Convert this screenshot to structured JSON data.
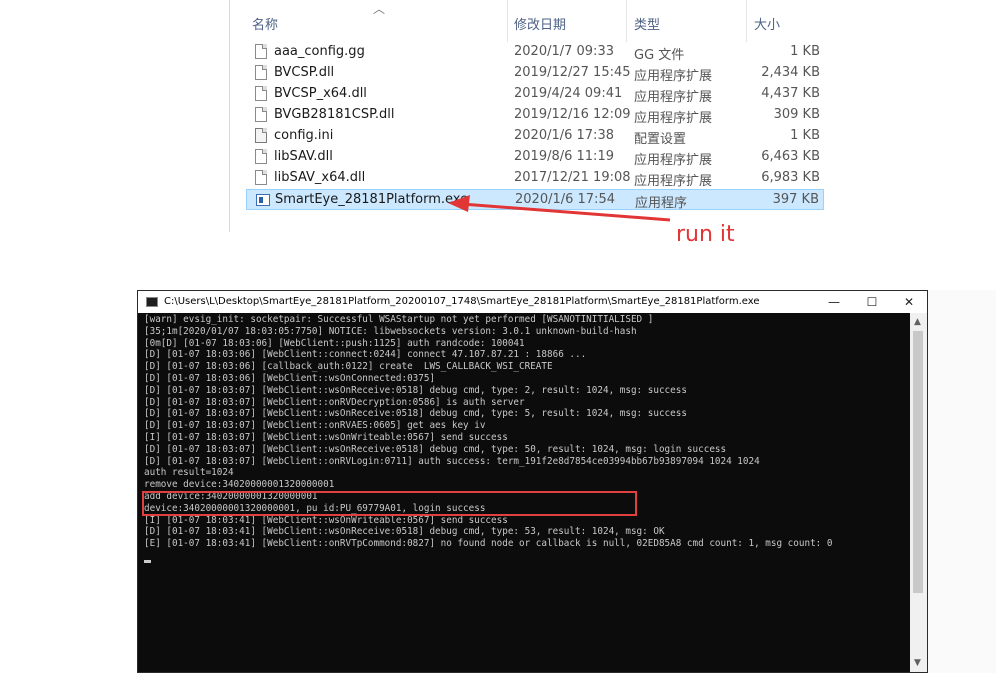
{
  "explorer": {
    "columns": [
      "名称",
      "修改日期",
      "类型",
      "大小"
    ],
    "files": [
      {
        "name": "aaa_config.gg",
        "date": "2020/1/7 09:33",
        "type": "GG 文件",
        "size": "1 KB",
        "icon": "file-icon"
      },
      {
        "name": "BVCSP.dll",
        "date": "2019/12/27 15:45",
        "type": "应用程序扩展",
        "size": "2,434 KB",
        "icon": "dll-icon"
      },
      {
        "name": "BVCSP_x64.dll",
        "date": "2019/4/24 09:41",
        "type": "应用程序扩展",
        "size": "4,437 KB",
        "icon": "dll-icon"
      },
      {
        "name": "BVGB28181CSP.dll",
        "date": "2019/12/16 12:09",
        "type": "应用程序扩展",
        "size": "309 KB",
        "icon": "dll-icon"
      },
      {
        "name": "config.ini",
        "date": "2020/1/6 17:38",
        "type": "配置设置",
        "size": "1 KB",
        "icon": "ini-gear-icon"
      },
      {
        "name": "libSAV.dll",
        "date": "2019/8/6 11:19",
        "type": "应用程序扩展",
        "size": "6,463 KB",
        "icon": "dll-icon"
      },
      {
        "name": "libSAV_x64.dll",
        "date": "2017/12/21 19:08",
        "type": "应用程序扩展",
        "size": "6,983 KB",
        "icon": "dll-icon"
      },
      {
        "name": "SmartEye_28181Platform.exe",
        "date": "2020/1/6 17:54",
        "type": "应用程序",
        "size": "397 KB",
        "icon": "exe-icon"
      }
    ]
  },
  "annotation": {
    "text": "run it",
    "color": "#e23535"
  },
  "console": {
    "title": "C:\\Users\\L\\Desktop\\SmartEye_28181Platform_20200107_1748\\SmartEye_28181Platform\\SmartEye_28181Platform.exe",
    "buttons": {
      "minimize": "—",
      "maximize": "☐",
      "close": "✕"
    },
    "lines": [
      "[warn] evsig_init: socketpair: Successful WSAStartup not yet performed [WSANOTINITIALISED ]",
      "[35;1m[2020/01/07 18:03:05:7750] NOTICE: libwebsockets version: 3.0.1 unknown-build-hash",
      "[0m[D] [01-07 18:03:06] [WebClient::push:1125] auth randcode: 100041",
      "[D] [01-07 18:03:06] [WebClient::connect:0244] connect 47.107.87.21 : 18866 ...",
      "[D] [01-07 18:03:06] [callback_auth:0122] create  LWS_CALLBACK_WSI_CREATE",
      "[D] [01-07 18:03:06] [WebClient::wsOnConnected:0375]",
      "[D] [01-07 18:03:07] [WebClient::wsOnReceive:0518] debug cmd, type: 2, result: 1024, msg: success",
      "[D] [01-07 18:03:07] [WebClient::onRVDecryption:0586] is auth server",
      "[D] [01-07 18:03:07] [WebClient::wsOnReceive:0518] debug cmd, type: 5, result: 1024, msg: success",
      "[D] [01-07 18:03:07] [WebClient::onRVAES:0605] get aes key iv",
      "[I] [01-07 18:03:07] [WebClient::wsOnWriteable:0567] send success",
      "[D] [01-07 18:03:07] [WebClient::wsOnReceive:0518] debug cmd, type: 50, result: 1024, msg: login success",
      "[D] [01-07 18:03:07] [WebClient::onRVLogin:0711] auth success: term_191f2e8d7854ce03994bb67b93897094 1024 1024",
      "auth result=1024",
      "remove device:34020000001320000001",
      "add device:34020000001320000001",
      "device:34020000001320000001, pu id:PU_69779A01, login success",
      "[I] [01-07 18:03:41] [WebClient::wsOnWriteable:0567] send success",
      "[D] [01-07 18:03:41] [WebClient::wsOnReceive:0518] debug cmd, type: 53, result: 1024, msg: OK",
      "[E] [01-07 18:03:41] [WebClient::onRVTpCommond:0827] no found node or callback is null, 02ED85A8 cmd count: 1, msg count: 0"
    ]
  },
  "colors": {
    "selection": "#cce8ff",
    "highlight_box": "#e04040",
    "console_bg": "#0c0c0c",
    "console_text": "#c8c8c8"
  }
}
